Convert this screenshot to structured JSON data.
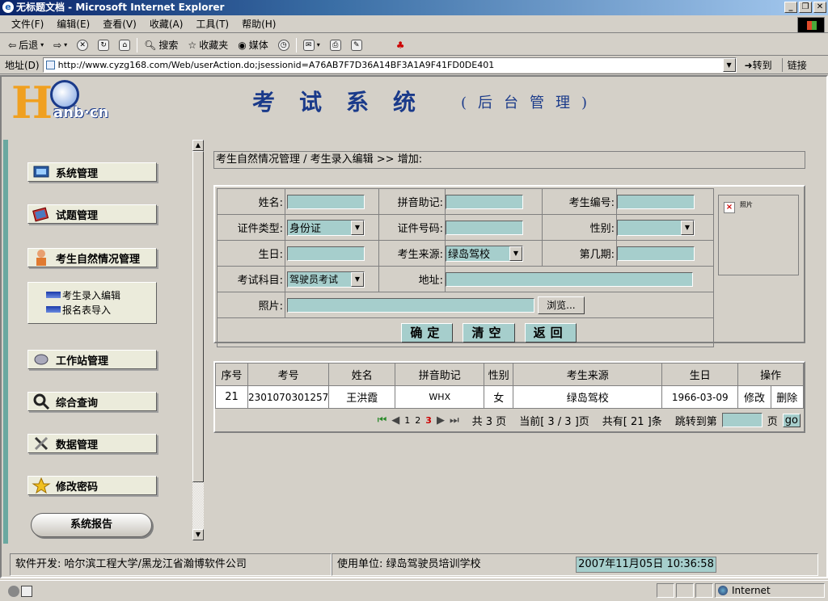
{
  "window": {
    "title": "无标题文档 - Microsoft Internet Explorer"
  },
  "menu": [
    "文件(F)",
    "编辑(E)",
    "查看(V)",
    "收藏(A)",
    "工具(T)",
    "帮助(H)"
  ],
  "toolbar": {
    "back": "后退",
    "search": "搜索",
    "favorites": "收藏夹",
    "media": "媒体"
  },
  "address": {
    "label": "地址(D)",
    "url": "http://www.cyzg168.com/Web/userAction.do;jsessionid=A76AB7F7D36A14BF3A1A9F41FD0DE401",
    "go": "转到",
    "links": "链接"
  },
  "header": {
    "logo_text": "anb·cn",
    "title": "考试系统",
    "subtitle": "(后台管理)"
  },
  "sidebar": {
    "items": [
      "系统管理",
      "试题管理",
      "考生自然情况管理",
      "工作站管理",
      "综合查询",
      "数据管理",
      "修改密码"
    ],
    "submenu": [
      "考生录入编辑",
      "报名表导入"
    ],
    "report": "系统报告"
  },
  "breadcrumb": "考生自然情况管理 / 考生录入编辑 >> 增加:",
  "form": {
    "name_label": "姓名:",
    "pinyin_label": "拼音助记:",
    "exam_no_label": "考生编号:",
    "id_type_label": "证件类型:",
    "id_type_value": "身份证",
    "id_no_label": "证件号码:",
    "gender_label": "性别:",
    "birthday_label": "生日:",
    "source_label": "考生来源:",
    "source_value": "绿岛驾校",
    "period_label": "第几期:",
    "subject_label": "考试科目:",
    "subject_value": "驾驶员考试",
    "address_label": "地址:",
    "photo_label": "照片:",
    "photo_alt": "照片",
    "browse": "浏览...",
    "confirm": "确定",
    "clear": "清空",
    "back": "返回"
  },
  "table": {
    "headers": [
      "序号",
      "考号",
      "姓名",
      "拼音助记",
      "性别",
      "考生来源",
      "生日",
      "操作"
    ],
    "rows": [
      {
        "seq": "21",
        "exam_no": "2301070301257",
        "name": "王洪霞",
        "pinyin": "WHX",
        "gender": "女",
        "source": "绿岛驾校",
        "birthday": "1966-03-09",
        "edit": "修改",
        "delete": "删除"
      }
    ]
  },
  "pager": {
    "page1": "1",
    "page2": "2",
    "page3": "3",
    "total_pages": "共 3 页",
    "current": "当前[ 3 / 3 ]页",
    "total_records": "共有[ 21 ]条",
    "jump_label": "跳转到第",
    "page_unit": "页",
    "go": "go"
  },
  "footer": {
    "developer": "软件开发: 哈尔滨工程大学/黑龙江省瀚博软件公司",
    "user": "使用单位: 绿岛驾驶员培训学校",
    "datetime": "2007年11月05日 10:36:58"
  },
  "status": {
    "zone": "Internet"
  },
  "colors": {
    "field": "#a6cecc",
    "title": "#1a3a8a",
    "logo": "#f0a020"
  }
}
